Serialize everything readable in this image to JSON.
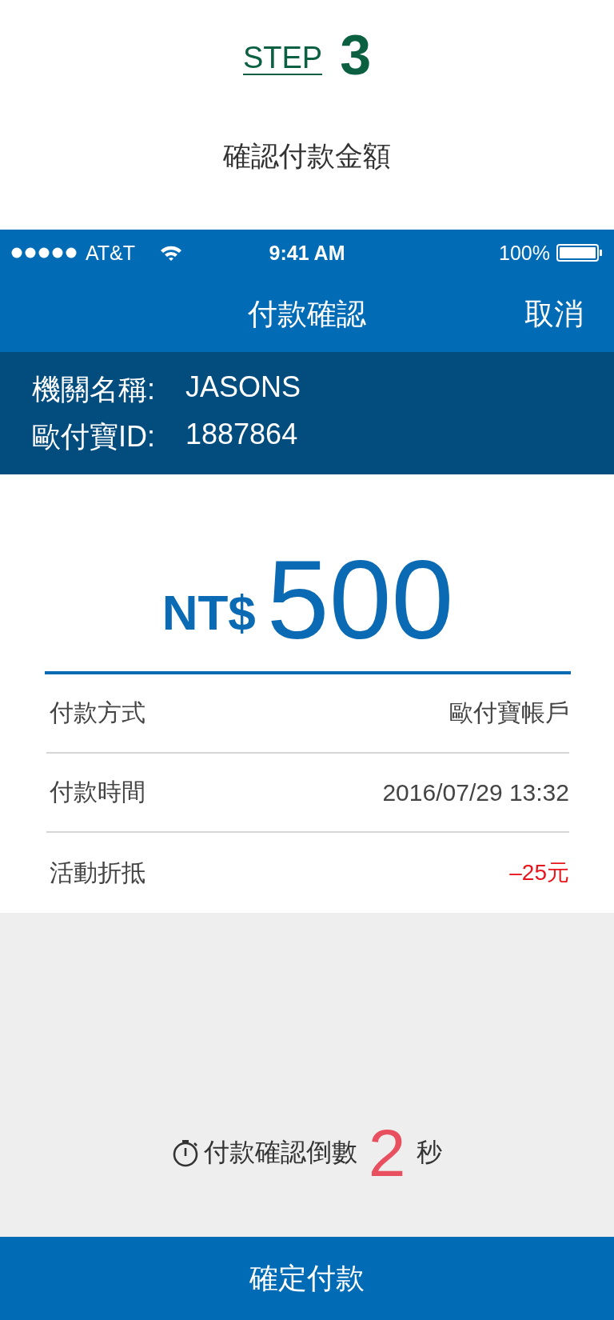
{
  "step": {
    "label": "STEP",
    "number": "3"
  },
  "heading": "確認付款金額",
  "status_bar": {
    "carrier": "AT&T",
    "time": "9:41 AM",
    "battery": "100%"
  },
  "nav": {
    "title": "付款確認",
    "cancel": "取消"
  },
  "merchant": [
    {
      "label": "機關名稱:",
      "value": "JASONS"
    },
    {
      "label": "歐付寶ID:",
      "value": "1887864"
    }
  ],
  "amount": {
    "currency": "NT$",
    "value": "500"
  },
  "details": [
    {
      "label": "付款方式",
      "value": "歐付寶帳戶",
      "kind": "normal"
    },
    {
      "label": "付款時間",
      "value": "2016/07/29 13:32",
      "kind": "normal"
    },
    {
      "label": "活動折抵",
      "value": "–25元",
      "kind": "discount"
    }
  ],
  "countdown": {
    "prefix": "付款確認倒數",
    "number": "2",
    "suffix": "秒"
  },
  "confirm_button": "確定付款"
}
